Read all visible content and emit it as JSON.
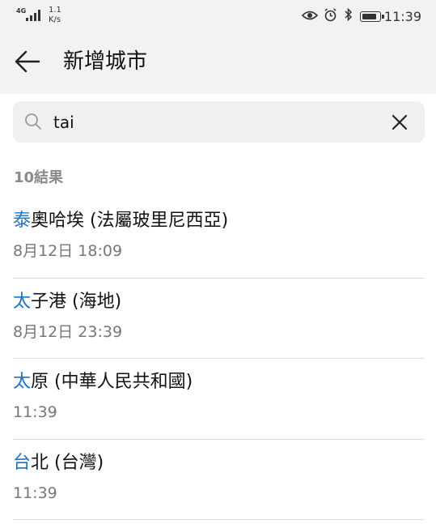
{
  "status_bar": {
    "network": "4G",
    "speed_value": "1.1",
    "speed_unit": "K/s",
    "time": "11:39",
    "icons": [
      "eye-icon",
      "alarm-icon",
      "bluetooth-icon",
      "battery-icon"
    ]
  },
  "app_bar": {
    "title": "新增城市",
    "back_icon": "arrow-left-icon"
  },
  "search": {
    "value": "tai",
    "icon": "search-icon",
    "clear_icon": "close-icon"
  },
  "results_count": "10結果",
  "results": [
    {
      "highlight": "泰",
      "rest": "奧哈埃 (法屬玻里尼西亞)",
      "time": "8月12日 18:09"
    },
    {
      "highlight": "太",
      "rest": "子港 (海地)",
      "time": "8月12日 23:39"
    },
    {
      "highlight": "太",
      "rest": "原 (中華人民共和國)",
      "time": "11:39"
    },
    {
      "highlight": "台",
      "rest": "北 (台灣)",
      "time": "11:39"
    }
  ],
  "colors": {
    "highlight": "#1a73c8",
    "header_bg": "#f2f2f2",
    "search_bg": "#f0f0f0",
    "secondary_text": "#777777"
  }
}
